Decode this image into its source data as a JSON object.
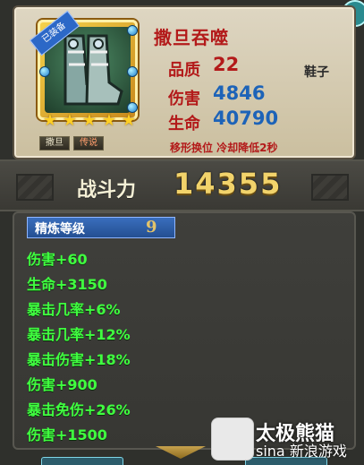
{
  "item": {
    "name": "撒旦吞噬",
    "equipped_badge": "已装备",
    "slot": "鞋子",
    "quality_label": "品质",
    "quality_value": "22",
    "damage_label": "伤害",
    "damage_value": "4846",
    "life_label": "生命",
    "life_value": "40790",
    "skill_text": "移形换位 冷却降低2秒",
    "tags": [
      "撒旦",
      "传说"
    ],
    "star_count": 5
  },
  "power": {
    "label": "战斗力",
    "value": "14355"
  },
  "refine": {
    "label": "精炼等级",
    "value": "9"
  },
  "attributes": [
    "伤害+60",
    "生命+3150",
    "暴击几率+6%",
    "暴击几率+12%",
    "暴击伤害+18%",
    "伤害+900",
    "暴击免伤+26%",
    "伤害+1500"
  ],
  "watermark": {
    "title": "太极熊猫",
    "subtitle": "sina 新浪游戏"
  },
  "colors": {
    "title_red": "#b31a1a",
    "value_blue": "#1d63b8",
    "attr_green": "#40ff40",
    "power_gold": "#f2d36b"
  }
}
